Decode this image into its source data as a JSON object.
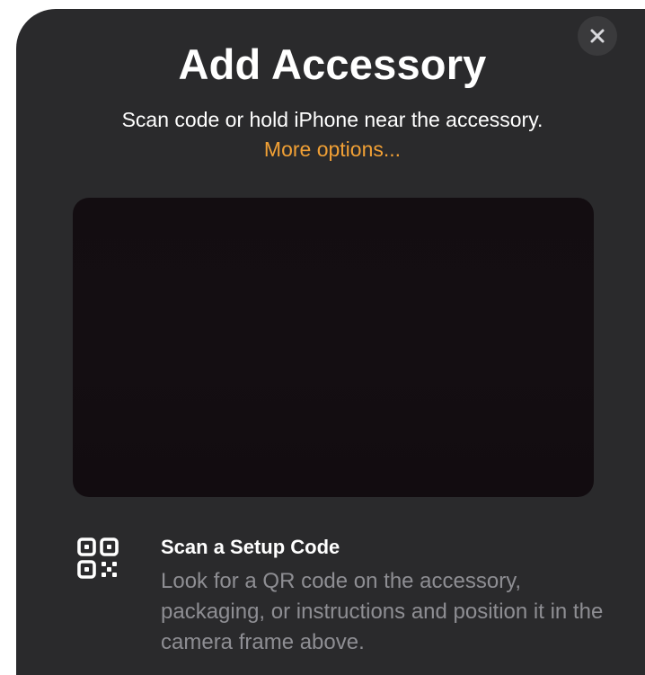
{
  "sheet": {
    "title": "Add Accessory",
    "subtitle_text": "Scan code or hold iPhone near the accessory.",
    "more_options_label": "More options...",
    "close_icon": "close-icon",
    "accent_color": "#f1a035"
  },
  "scan_option": {
    "icon": "qr-code-icon",
    "title": "Scan a Setup Code",
    "description": "Look for a QR code on the accessory, packaging, or instructions and position it in the camera frame above."
  }
}
